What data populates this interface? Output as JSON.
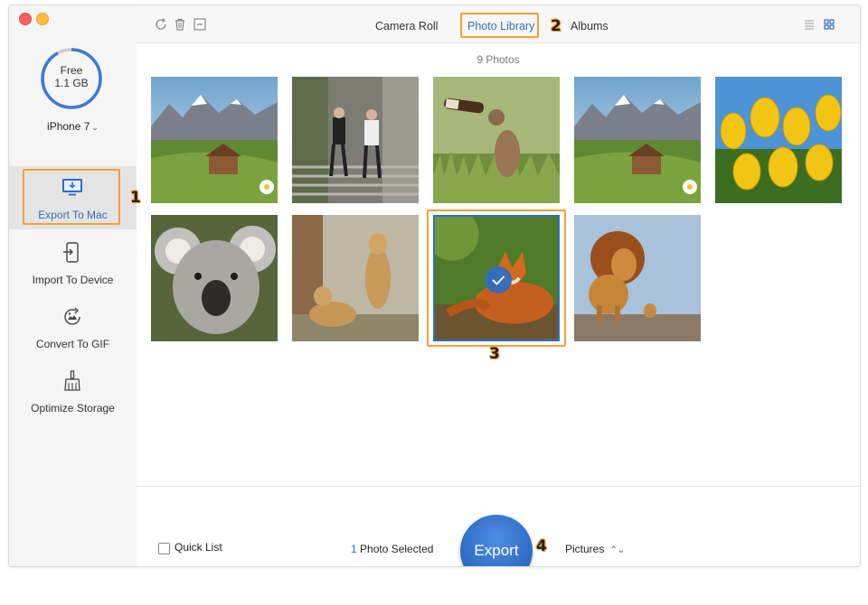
{
  "storage": {
    "label": "Free",
    "amount": "1.1 GB",
    "used_fraction": 0.08
  },
  "device": {
    "name": "iPhone 7"
  },
  "sidebar": {
    "items": [
      {
        "label": "Export To Mac",
        "icon": "monitor-download-icon",
        "active": true
      },
      {
        "label": "Import To Device",
        "icon": "phone-import-icon",
        "active": false
      },
      {
        "label": "Convert To GIF",
        "icon": "gif-convert-icon",
        "active": false
      },
      {
        "label": "Optimize Storage",
        "icon": "broom-icon",
        "active": false
      }
    ]
  },
  "toolbar": {
    "icons": [
      "refresh-icon",
      "trash-icon",
      "deselect-icon"
    ],
    "tabs": [
      {
        "label": "Camera Roll",
        "active": false
      },
      {
        "label": "Photo Library",
        "active": true
      },
      {
        "label": "Albums",
        "active": false
      }
    ],
    "view_icons": [
      "list-view-icon",
      "grid-view-icon"
    ]
  },
  "grid": {
    "count_label": "9 Photos",
    "photos": [
      {
        "subject": "mountain-cabin",
        "selected": false
      },
      {
        "subject": "couple-stairs",
        "selected": false
      },
      {
        "subject": "squirrel-bottle",
        "selected": false
      },
      {
        "subject": "mountain-cabin",
        "selected": false
      },
      {
        "subject": "yellow-tulips",
        "selected": false
      },
      {
        "subject": "koala",
        "selected": false
      },
      {
        "subject": "lionesses",
        "selected": false
      },
      {
        "subject": "fox",
        "selected": true
      },
      {
        "subject": "lion-cub",
        "selected": false
      }
    ]
  },
  "footer": {
    "quick_list_label": "Quick List",
    "selected_count": "1",
    "selected_label": " Photo Selected",
    "export_label": "Export",
    "destination": "Pictures"
  },
  "steps": [
    "1",
    "2",
    "3",
    "4"
  ],
  "colors": {
    "accent": "#2f6ec2",
    "highlight": "#f5a030"
  }
}
